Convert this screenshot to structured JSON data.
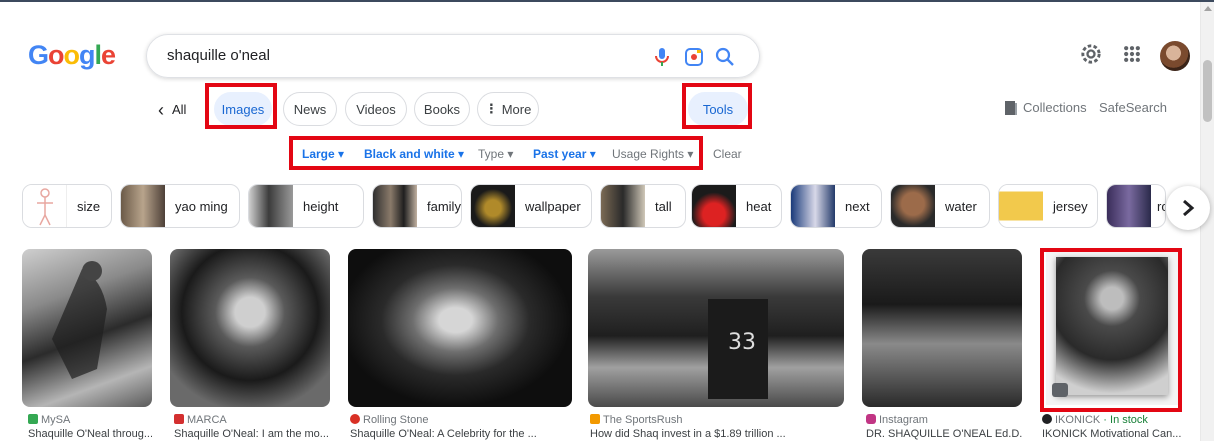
{
  "search": {
    "query": "shaquille o'neal"
  },
  "nav": {
    "back_label": "‹",
    "all_label": "All",
    "tabs": [
      "Images",
      "News",
      "Videos",
      "Books",
      "More"
    ],
    "more_prefix": "⋮",
    "tools_label": "Tools",
    "collections_label": "Collections",
    "safesearch_label": "SafeSearch"
  },
  "filters": [
    {
      "label": "Large ▾",
      "active": true
    },
    {
      "label": "Black and white ▾",
      "active": true
    },
    {
      "label": "Type ▾",
      "active": false
    },
    {
      "label": "Past year ▾",
      "active": true
    },
    {
      "label": "Usage Rights ▾",
      "active": false
    },
    {
      "label": "Clear",
      "active": false
    }
  ],
  "chips": [
    "size",
    "yao ming",
    "height",
    "family",
    "wallpaper",
    "tall",
    "heat",
    "next",
    "water",
    "jersey",
    "ro"
  ],
  "results": [
    {
      "source": "MySA",
      "title": "Shaquille O'Neal throug..."
    },
    {
      "source": "MARCA",
      "title": "Shaquille O'Neal: I am the mo..."
    },
    {
      "source": "Rolling Stone",
      "title": "Shaquille O'Neal: A Celebrity for the ..."
    },
    {
      "source": "The SportsRush",
      "title": "How did Shaq invest in a $1.89 trillion ..."
    },
    {
      "source": "Instagram",
      "title": "DR. SHAQUILLE O'NEAL Ed.D. ..."
    },
    {
      "source": "IKONICK",
      "stock": "· In stock",
      "title": "IKONICK Motivational Can..."
    }
  ],
  "colors": {
    "accent": "#1a73e8",
    "highlight_box": "#e30613",
    "chip_border": "#dadce0"
  },
  "icons": [
    "mic-icon",
    "lens-icon",
    "search-icon",
    "settings-icon",
    "apps-grid-icon",
    "collections-icon",
    "chevron-right-icon"
  ]
}
